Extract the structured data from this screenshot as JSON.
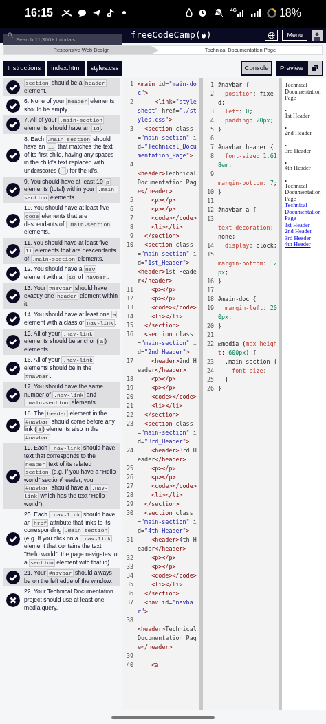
{
  "status_bar": {
    "time": "16:15",
    "network": "4G",
    "battery": "18%"
  },
  "navbar": {
    "search": {
      "placeholder": "Search 11,300+ tutorials"
    },
    "logo": {
      "prefix": "freeCodeCamp(",
      "suffix": ")"
    },
    "menu": "Menu"
  },
  "breadcrumb": [
    {
      "label": "Responsive Web Design",
      "selected": false
    },
    {
      "label": "Technical Documentation Page",
      "selected": true
    }
  ],
  "tabs": [
    {
      "label": "Instructions",
      "selected": true
    },
    {
      "label": "index.html",
      "selected": true
    },
    {
      "label": "styles.css",
      "selected": true
    }
  ],
  "right_tabs": [
    {
      "label": "Console",
      "selected": false
    },
    {
      "label": "Preview",
      "selected": true
    }
  ],
  "instructions": [
    {
      "passed": true,
      "parts": [
        {
          "code": "section"
        },
        {
          "text": " should be a "
        },
        {
          "code": "header"
        },
        {
          "text": " element."
        }
      ]
    },
    {
      "passed": true,
      "parts": [
        {
          "text": "6. None of your "
        },
        {
          "code": "header"
        },
        {
          "text": " elements should be empty."
        }
      ]
    },
    {
      "passed": true,
      "parts": [
        {
          "text": "7. All of your "
        },
        {
          "code": ".main-section"
        },
        {
          "text": " elements should have an "
        },
        {
          "code": "id"
        },
        {
          "text": "."
        }
      ]
    },
    {
      "passed": true,
      "parts": [
        {
          "text": "8. Each "
        },
        {
          "code": ".main-section"
        },
        {
          "text": " should have an "
        },
        {
          "code": "id"
        },
        {
          "text": " that matches the text of its first child, having any spaces in the child's text replaced with underscores ("
        },
        {
          "code": "_"
        },
        {
          "text": ") for the id's."
        }
      ]
    },
    {
      "passed": true,
      "parts": [
        {
          "text": "9. You should have at least 10 "
        },
        {
          "code": "p"
        },
        {
          "text": " elements (total) within your "
        },
        {
          "code": ".main-section"
        },
        {
          "text": " elements."
        }
      ]
    },
    {
      "passed": true,
      "parts": [
        {
          "text": "10. You should have at least five "
        },
        {
          "code": "code"
        },
        {
          "text": " elements that are descendants of "
        },
        {
          "code": ".main-section"
        },
        {
          "text": " elements."
        }
      ]
    },
    {
      "passed": true,
      "parts": [
        {
          "text": "11. You should have at least five "
        },
        {
          "code": "li"
        },
        {
          "text": " elements that are descendants of "
        },
        {
          "code": ".main-section"
        },
        {
          "text": " elements."
        }
      ]
    },
    {
      "passed": true,
      "parts": [
        {
          "text": "12. You should have a "
        },
        {
          "code": "nav"
        },
        {
          "text": " element with an "
        },
        {
          "code": "id"
        },
        {
          "text": " of "
        },
        {
          "code": "navbar"
        },
        {
          "text": "."
        }
      ]
    },
    {
      "passed": true,
      "parts": [
        {
          "text": "13. Your "
        },
        {
          "code": "#navbar"
        },
        {
          "text": " should have exactly one "
        },
        {
          "code": "header"
        },
        {
          "text": " element within it."
        }
      ]
    },
    {
      "passed": true,
      "parts": [
        {
          "text": "14. You should have at least one "
        },
        {
          "code": "a"
        },
        {
          "text": " element with a class of "
        },
        {
          "code": "nav-link"
        },
        {
          "text": "."
        }
      ]
    },
    {
      "passed": true,
      "parts": [
        {
          "text": "15. All of your "
        },
        {
          "code": ".nav-link"
        },
        {
          "text": " elements should be anchor ("
        },
        {
          "code": "a"
        },
        {
          "text": ") elements."
        }
      ]
    },
    {
      "passed": true,
      "parts": [
        {
          "text": "16. All of your "
        },
        {
          "code": ".nav-link"
        },
        {
          "text": " elements should be in the "
        },
        {
          "code": "#navbar"
        },
        {
          "text": "."
        }
      ]
    },
    {
      "passed": true,
      "parts": [
        {
          "text": "17. You should have the same number of "
        },
        {
          "code": ".nav-link"
        },
        {
          "text": " and "
        },
        {
          "code": ".main-section"
        },
        {
          "text": " elements."
        }
      ]
    },
    {
      "passed": true,
      "parts": [
        {
          "text": "18. The "
        },
        {
          "code": "header"
        },
        {
          "text": " element in the "
        },
        {
          "code": "#navbar"
        },
        {
          "text": " should come before any link ("
        },
        {
          "code": "a"
        },
        {
          "text": ") elements also in the "
        },
        {
          "code": "#navbar"
        },
        {
          "text": "."
        }
      ]
    },
    {
      "passed": true,
      "parts": [
        {
          "text": "19. Each "
        },
        {
          "code": ".nav-link"
        },
        {
          "text": " should have text that corresponds to the "
        },
        {
          "code": "header"
        },
        {
          "text": " text of its related "
        },
        {
          "code": "section"
        },
        {
          "text": " (e.g. if you have a \"Hello world\" section/header, your "
        },
        {
          "code": "#navbar"
        },
        {
          "text": " should have a "
        },
        {
          "code": ".nav-link"
        },
        {
          "text": " which has the text \"Hello world\")."
        }
      ]
    },
    {
      "passed": true,
      "parts": [
        {
          "text": "20. Each "
        },
        {
          "code": ".nav-link"
        },
        {
          "text": " should have an "
        },
        {
          "code": "href"
        },
        {
          "text": " attribute that links to its corresponding "
        },
        {
          "code": ".main-section"
        },
        {
          "text": " (e.g. If you click on a "
        },
        {
          "code": ".nav-link"
        },
        {
          "text": " element that contains the text \"Hello world\", the page navigates to a "
        },
        {
          "code": "section"
        },
        {
          "text": " element with that id)."
        }
      ]
    },
    {
      "passed": true,
      "parts": [
        {
          "text": "21. Your "
        },
        {
          "code": "#navbar"
        },
        {
          "text": " should always be on the left edge of the window."
        }
      ]
    },
    {
      "passed": false,
      "parts": [
        {
          "text": "22. Your Technical Documentation project should use at least one media query."
        }
      ]
    }
  ],
  "html_editor": [
    {
      "n": "1",
      "code": "<main id=\"main-doc\">"
    },
    {
      "n": "2",
      "code": "     <link=\"stylesheet\" href=\"./styles.css\">"
    },
    {
      "n": "3",
      "code": "  <section class=\"main-section\" id=\"Technical_Documentation_Page\">"
    },
    {
      "n": "4",
      "code": "                 <header>Technical Documentation Page</header>"
    },
    {
      "n": "5",
      "code": "    <p></p>"
    },
    {
      "n": "6",
      "code": "    <p></p>"
    },
    {
      "n": "7",
      "code": "    <code></code>"
    },
    {
      "n": "8",
      "code": "    <li></li>"
    },
    {
      "n": "9",
      "code": "  </section>"
    },
    {
      "n": "10",
      "code": "  <section class=\"main-section\" id=\"1st_Header\">       <header>1st Header</header>"
    },
    {
      "n": "11",
      "code": "    <p></p>"
    },
    {
      "n": "12",
      "code": "    <p></p>"
    },
    {
      "n": "13",
      "code": "    <code></code>"
    },
    {
      "n": "14",
      "code": "    <li></li>"
    },
    {
      "n": "15",
      "code": "  </section>"
    },
    {
      "n": "16",
      "code": "  <section class=\"main-section\" id=\"2nd_Header\">"
    },
    {
      "n": "17",
      "code": "    <header>2nd Header</header>"
    },
    {
      "n": "18",
      "code": "    <p></p>"
    },
    {
      "n": "19",
      "code": "    <p></p>"
    },
    {
      "n": "20",
      "code": "    <code></code>"
    },
    {
      "n": "21",
      "code": "    <li></li>"
    },
    {
      "n": "22",
      "code": "  </section>"
    },
    {
      "n": "23",
      "code": "  <section class=\"main-section\" id=\"3rd_Header\">"
    },
    {
      "n": "24",
      "code": "    <header>3rd Header</header>"
    },
    {
      "n": "25",
      "code": "    <p></p>"
    },
    {
      "n": "26",
      "code": "    <p></p>"
    },
    {
      "n": "27",
      "code": "    <code></code>"
    },
    {
      "n": "28",
      "code": "    <li></li>"
    },
    {
      "n": "29",
      "code": "  </section>"
    },
    {
      "n": "30",
      "code": "  <section class=\"main-section\" id=\"4th_Header\">"
    },
    {
      "n": "31",
      "code": "    <header>4th Header</header>"
    },
    {
      "n": "32",
      "code": "    <p></p>"
    },
    {
      "n": "33",
      "code": "    <p></p>"
    },
    {
      "n": "34",
      "code": "    <code></code>"
    },
    {
      "n": "35",
      "code": "    <li></li>"
    },
    {
      "n": "36",
      "code": "  </section>"
    },
    {
      "n": "37",
      "code": "  <nav id=\"navbar\">"
    },
    {
      "n": "38",
      "code": "                 <header>Technical Documentation Page</header>"
    },
    {
      "n": "39"
    },
    {
      "n": "40",
      "code": "    <a"
    }
  ],
  "css_editor": [
    {
      "n": "1",
      "code": "#navbar {"
    },
    {
      "n": "2",
      "code": "  position: fixed;"
    },
    {
      "n": "3",
      "code": "  left: 0;"
    },
    {
      "n": "4",
      "code": "  padding: 20px;"
    },
    {
      "n": "5",
      "code": "}"
    },
    {
      "n": "6"
    },
    {
      "n": "7",
      "code": "#navbar header {"
    },
    {
      "n": "8",
      "code": "  font-size: 1.618em;"
    },
    {
      "n": "9",
      "code": "                 margin-bottom: 7;"
    },
    {
      "n": "10",
      "code": "}"
    },
    {
      "n": "11"
    },
    {
      "n": "12",
      "code": "#navbar a {"
    },
    {
      "n": "13",
      "code": "                 text-decoration: none;"
    },
    {
      "n": "14",
      "code": "  display: block;"
    },
    {
      "n": "15",
      "code": "                 margin-bottom: 12px;"
    },
    {
      "n": "16",
      "code": "}"
    },
    {
      "n": "17"
    },
    {
      "n": "18",
      "code": "#main-doc {"
    },
    {
      "n": "19",
      "code": "  margin-left: 200px;"
    },
    {
      "n": "20",
      "code": "}"
    },
    {
      "n": "21"
    },
    {
      "n": "22",
      "code": "@media (max-height: 600px) {"
    },
    {
      "n": "23",
      "code": "  .main-section {"
    },
    {
      "n": "24",
      "code": "    font-size:"
    },
    {
      "n": "25",
      "code": "  }"
    },
    {
      "n": "26",
      "code": "}"
    }
  ],
  "preview": [
    {
      "kind": "text",
      "text": "Technical Documentation Page"
    },
    {
      "kind": "bullet",
      "text": "•"
    },
    {
      "kind": "text",
      "text": "1st Header"
    },
    {
      "kind": "bullet",
      "text": "•"
    },
    {
      "kind": "text",
      "text": "2nd Header"
    },
    {
      "kind": "bullet",
      "text": "•"
    },
    {
      "kind": "text",
      "text": "3rd Header"
    },
    {
      "kind": "bullet",
      "text": "•"
    },
    {
      "kind": "text",
      "text": "4th Header"
    },
    {
      "kind": "bullet",
      "text": "•"
    },
    {
      "kind": "text",
      "text": "Technical Documentation Page"
    },
    {
      "kind": "links",
      "links": [
        "Technical Documentation Page",
        "1st Header",
        "2nd Header",
        "3rd Header",
        "4th Header"
      ]
    }
  ]
}
